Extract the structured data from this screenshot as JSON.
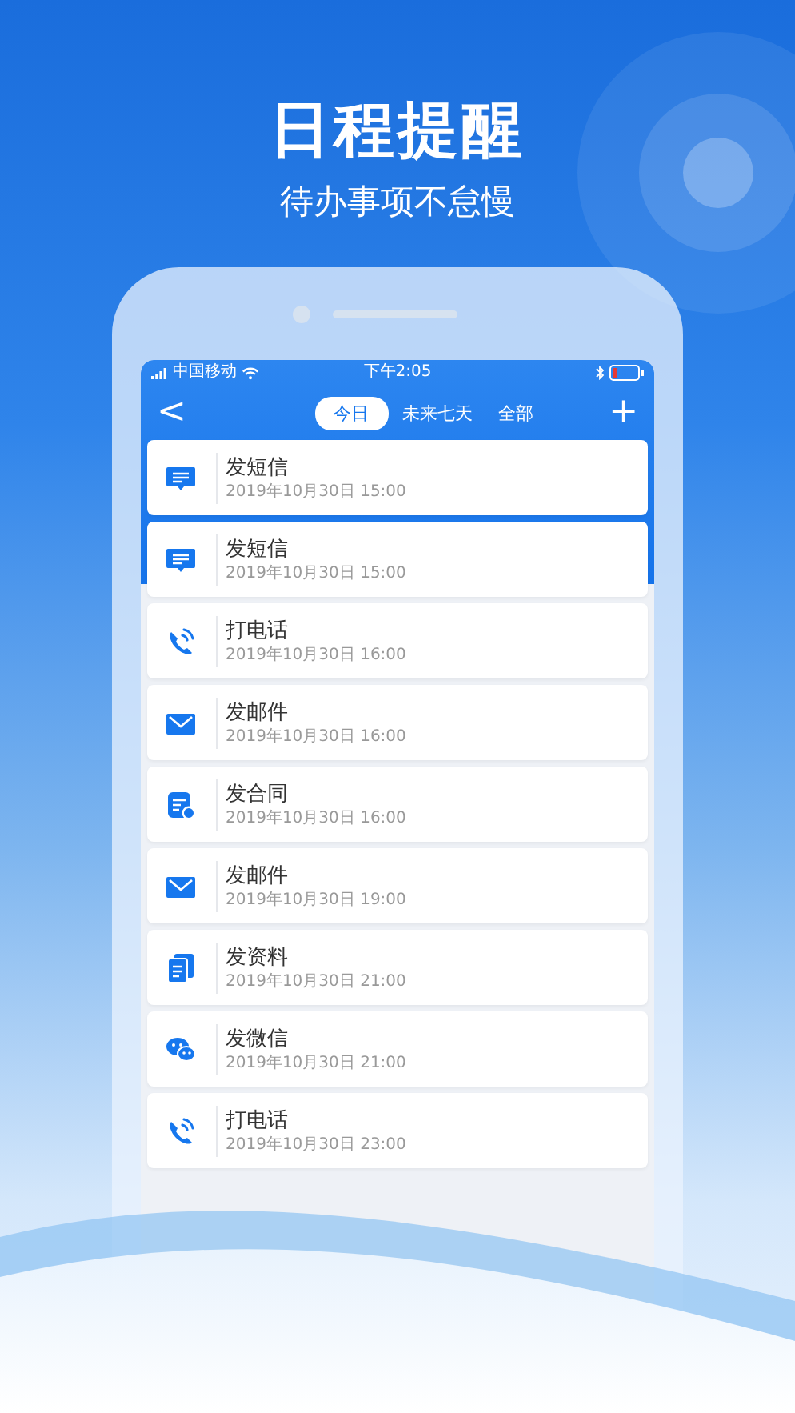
{
  "headline": {
    "title": "日程提醒",
    "subtitle": "待办事项不怠慢"
  },
  "status_bar": {
    "carrier": "中国移动",
    "time": "下午2:05"
  },
  "nav": {
    "back": "<",
    "add": "+"
  },
  "tabs": [
    {
      "label": "今日",
      "selected": true
    },
    {
      "label": "未来七天",
      "selected": false
    },
    {
      "label": "全部",
      "selected": false
    }
  ],
  "reminders": [
    {
      "kind": "sms",
      "title": "发短信",
      "time": "2019年10月30日 15:00"
    },
    {
      "kind": "sms",
      "title": "发短信",
      "time": "2019年10月30日 15:00"
    },
    {
      "kind": "call",
      "title": "打电话",
      "time": "2019年10月30日 16:00"
    },
    {
      "kind": "mail",
      "title": "发邮件",
      "time": "2019年10月30日 16:00"
    },
    {
      "kind": "contract",
      "title": "发合同",
      "time": "2019年10月30日 16:00"
    },
    {
      "kind": "mail",
      "title": "发邮件",
      "time": "2019年10月30日 19:00"
    },
    {
      "kind": "docs",
      "title": "发资料",
      "time": "2019年10月30日 21:00"
    },
    {
      "kind": "wechat",
      "title": "发微信",
      "time": "2019年10月30日 21:00"
    },
    {
      "kind": "call",
      "title": "打电话",
      "time": "2019年10月30日 23:00"
    }
  ]
}
